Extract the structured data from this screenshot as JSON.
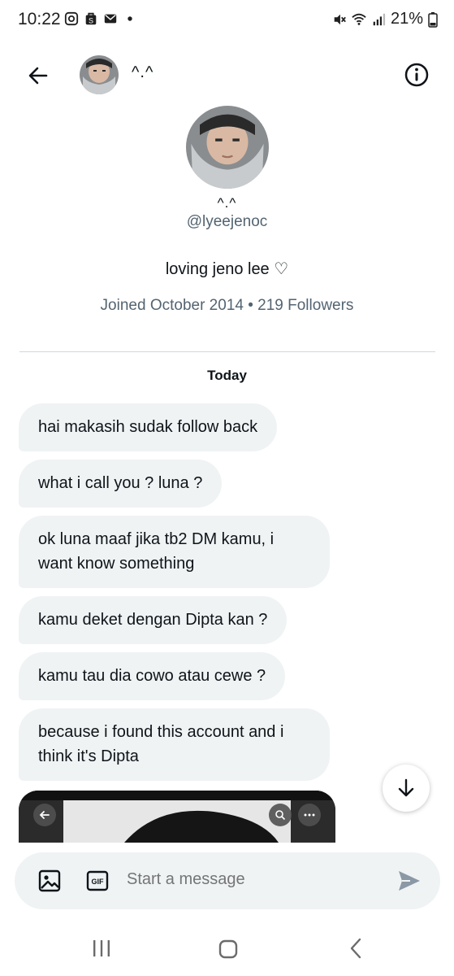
{
  "status_bar": {
    "time": "10:22",
    "battery": "21%"
  },
  "header": {
    "name": "^.^",
    "back_icon": "arrow-left-icon",
    "info_icon": "info-icon"
  },
  "profile": {
    "name": "^.^",
    "handle": "@lyeejenoc",
    "bio": "loving jeno lee ♡",
    "meta": "Joined October 2014 • 219 Followers"
  },
  "conversation": {
    "date_label": "Today",
    "messages": [
      "hai makasih sudak follow back",
      "what i call you ? luna ?",
      "ok luna maaf jika tb2 DM kamu, i want know something",
      "kamu deket dengan Dipta kan ?",
      "kamu tau dia cowo atau cewe ?",
      "because i found this account and i think it's Dipta"
    ]
  },
  "composer": {
    "placeholder": "Start a message",
    "gif_label": "GIF"
  },
  "colors": {
    "bubble_bg": "#eff3f4",
    "muted_text": "#536471",
    "divider": "#cfd9de",
    "send_icon": "#8b98a5"
  }
}
